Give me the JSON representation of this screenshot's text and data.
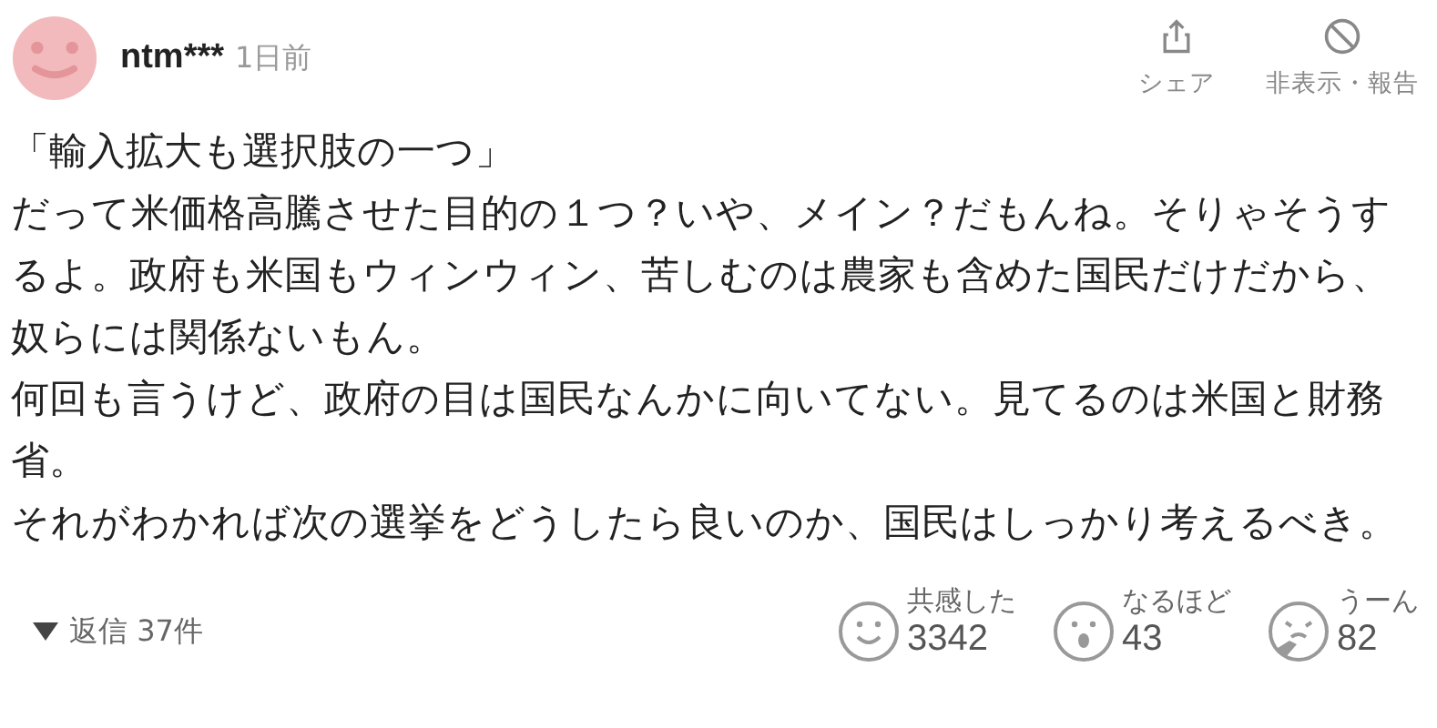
{
  "user": {
    "name": "ntm***",
    "time": "1日前"
  },
  "actions": [
    {
      "kind": "share",
      "label": "シェア"
    },
    {
      "kind": "hide",
      "label": "非表示・報告"
    }
  ],
  "paragraphs": [
    "「輸入拡大も選択肢の一つ」",
    "だって米価格高騰させた目的の１つ？いや、メイン？だもんね。そりゃそうするよ。政府も米国もウィンウィン、苦しむのは農家も含めた国民だけだから、奴らには関係ないもん。",
    "何回も言うけど、政府の目は国民なんかに向いてない。見てるのは米国と財務省。",
    "それがわかれば次の選挙をどうしたら良いのか、国民はしっかり考えるべき。"
  ],
  "replies": {
    "label": "返信 37件",
    "expanded": false
  },
  "reactions": [
    {
      "kind": "smile",
      "label": "共感した",
      "count": "3342"
    },
    {
      "kind": "surprise",
      "label": "なるほど",
      "count": "43"
    },
    {
      "kind": "think",
      "label": "うーん",
      "count": "82"
    }
  ]
}
